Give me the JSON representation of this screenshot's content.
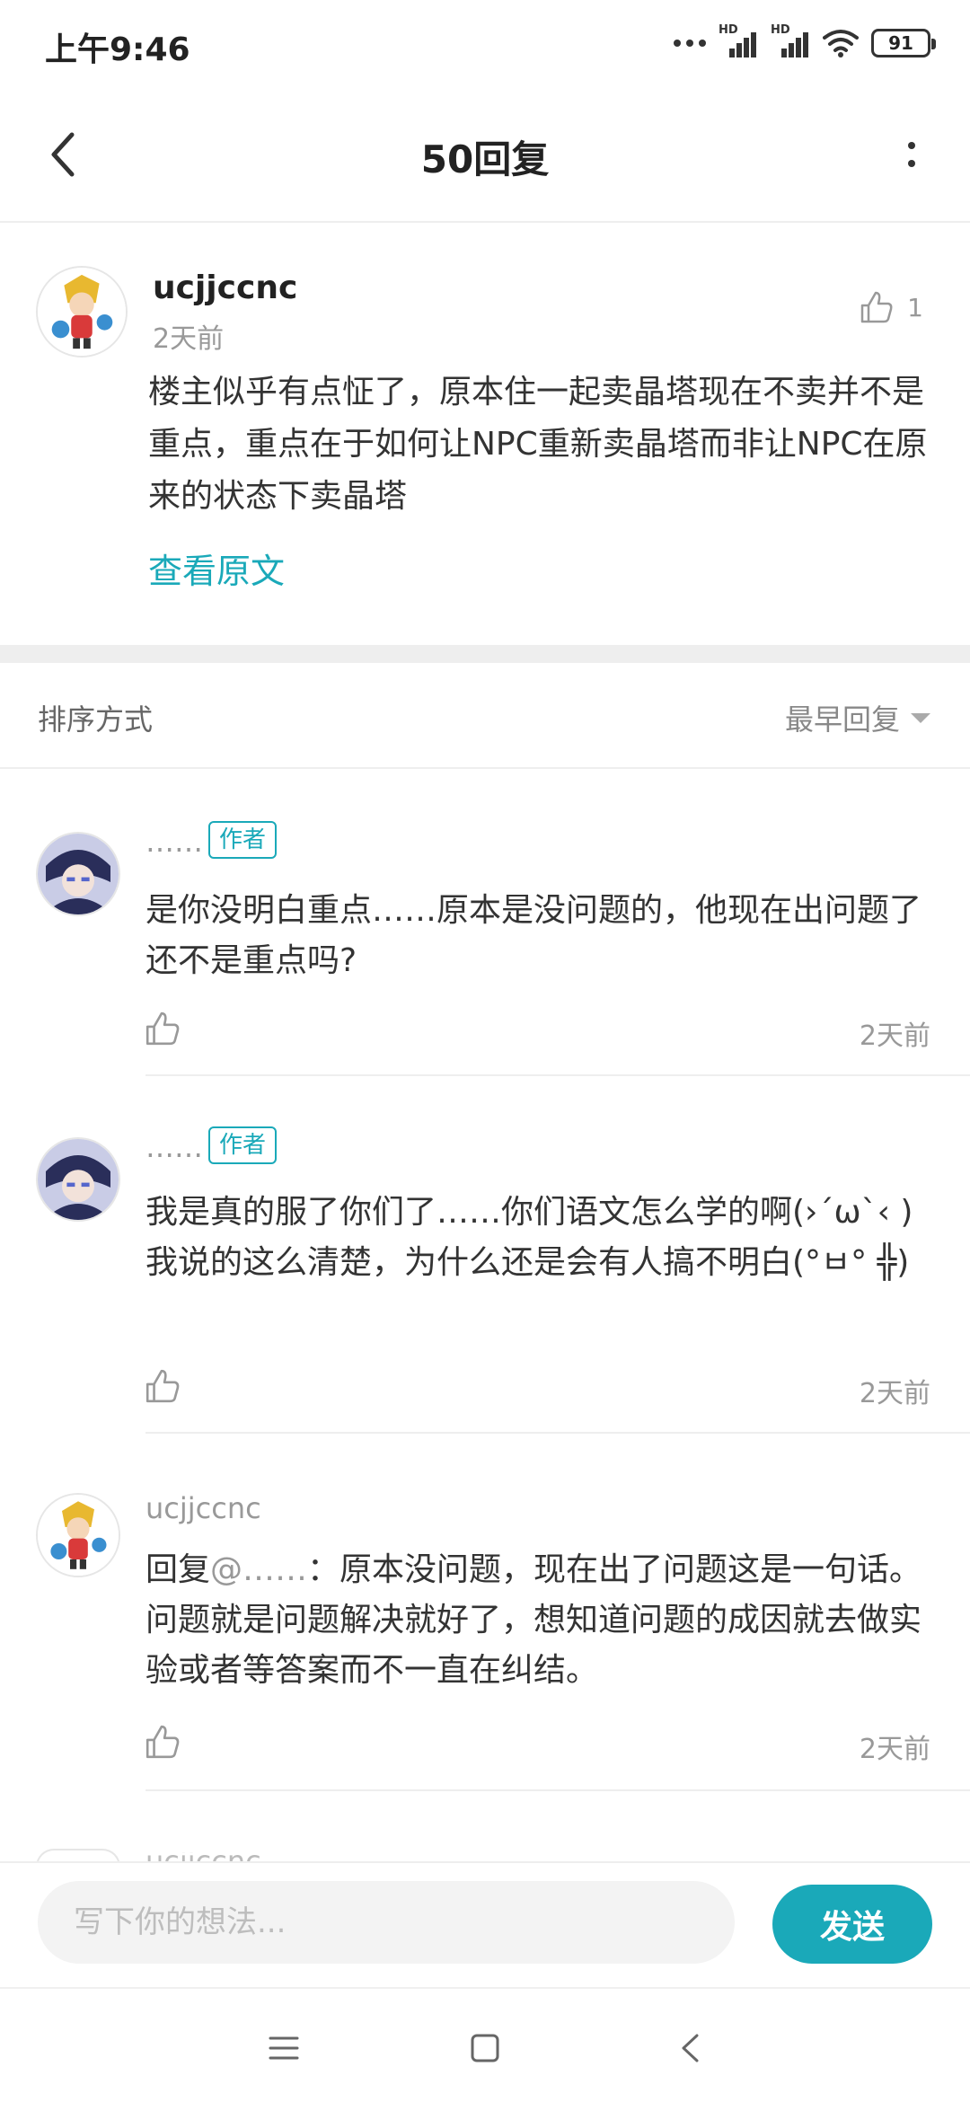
{
  "status_bar": {
    "time": "上午9:46",
    "battery": "91",
    "network_hd_1": "HD",
    "network_hd_2": "HD"
  },
  "header": {
    "title": "50回复",
    "back_icon": "chevron-left-icon",
    "more_icon": "more-vertical-icon"
  },
  "main_post": {
    "username": "ucjjccnc",
    "time": "2天前",
    "likes": "1",
    "content": "楼主似乎有点怔了，原本住一起卖晶塔现在不卖并不是重点，重点在于如何让NPC重新卖晶塔而非让NPC在原来的状态下卖晶塔",
    "view_original": "查看原文"
  },
  "sort": {
    "label": "排序方式",
    "value": "最早回复"
  },
  "replies": [
    {
      "username": "……",
      "badge": "作者",
      "content": "是你没明白重点……原本是没问题的，他现在出问题了还不是重点吗?",
      "time": "2天前"
    },
    {
      "username": "……",
      "badge": "作者",
      "content": "我是真的服了你们了……你们语文怎么学的啊(›´ω`‹ )我说的这么清楚，为什么还是会有人搞不明白(°ㅂ° ╬)",
      "time": "2天前"
    },
    {
      "username": "ucjjccnc",
      "reply_prefix": "回复",
      "mention": "@……",
      "content": "：原本没问题，现在出了问题这是一句话。问题就是问题解决就好了，想知道问题的成因就去做实验或者等答案而不一直在纠结。",
      "time": "2天前"
    }
  ],
  "next_reply_peek": {
    "username": "ucjjccnc"
  },
  "composer": {
    "placeholder": "写下你的想法...",
    "send_label": "发送"
  },
  "colors": {
    "accent": "#1aa9b9",
    "divider": "#eeeeee",
    "muted_text": "#999999"
  }
}
